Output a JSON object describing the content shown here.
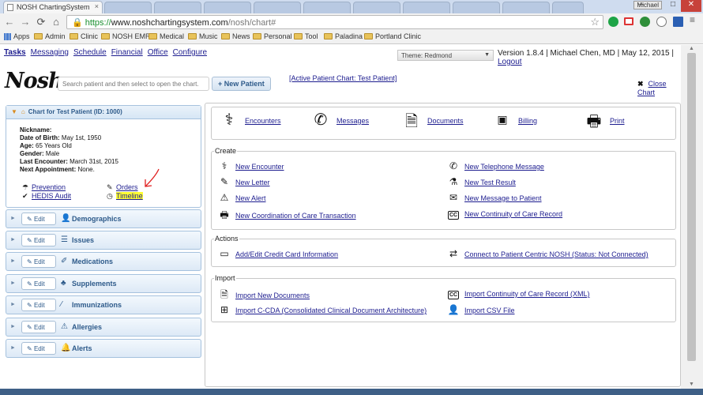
{
  "browser": {
    "active_tab_title": "NOSH ChartingSystem",
    "user_chip": "Michael",
    "url": {
      "scheme": "https://",
      "host": "www.noshchartingsystem.com",
      "path": "/nosh/chart#"
    },
    "bookmarks": [
      "Apps",
      "Admin",
      "Clinic",
      "NOSH EMR",
      "Medical",
      "Music",
      "News",
      "Personal",
      "Tool",
      "Paladina",
      "Portland Clinic"
    ]
  },
  "nav": {
    "links": [
      "Tasks",
      "Messaging",
      "Schedule",
      "Financial",
      "Office",
      "Configure"
    ],
    "theme_select": "Theme: Redmond",
    "version": "Version 1.8.4",
    "user": "Michael Chen, MD",
    "date": "May 12, 2015",
    "logout": "Logout",
    "sep": "|"
  },
  "header": {
    "logo": "Nosh",
    "search_placeholder": "Search patient and then select to open the chart.",
    "new_patient": "New Patient",
    "active_chart": "[Active Patient Chart: Test Patient]",
    "close_chart": "Close Chart"
  },
  "patient": {
    "panel_title": "Chart for Test Patient (ID: 1000)",
    "fields": [
      {
        "label": "Nickname:",
        "value": ""
      },
      {
        "label": "Date of Birth:",
        "value": "May 1st, 1950"
      },
      {
        "label": "Age:",
        "value": "65 Years Old"
      },
      {
        "label": "Gender:",
        "value": "Male"
      },
      {
        "label": "Last Encounter:",
        "value": "March 31st, 2015"
      },
      {
        "label": "Next Appointment:",
        "value": "None."
      }
    ],
    "links": {
      "prevention": "Prevention",
      "hedis": "HEDIS Audit",
      "orders": "Orders",
      "timeline": "Timeline"
    }
  },
  "sections": {
    "edit_label": "Edit",
    "items": [
      "Demographics",
      "Issues",
      "Medications",
      "Supplements",
      "Immunizations",
      "Allergies",
      "Alerts"
    ]
  },
  "toplinks": [
    "Encounters",
    "Messages",
    "Documents",
    "Billing",
    "Print"
  ],
  "create": {
    "legend": "Create",
    "left": [
      "New Encounter",
      "New Letter",
      "New Alert",
      "New Coordination of Care Transaction"
    ],
    "right": [
      "New Telephone Message",
      "New Test Result",
      "New Message to Patient",
      "New Continuity of Care Record"
    ]
  },
  "actions": {
    "legend": "Actions",
    "left": "Add/Edit Credit Card Information",
    "right": "Connect to Patient Centric NOSH (Status: Not Connected)"
  },
  "import": {
    "legend": "Import",
    "left": [
      "Import New Documents",
      "Import C-CDA (Consolidated Clinical Document Architecture)"
    ],
    "right": [
      "Import Continuity of Care Record (XML)",
      "Import CSV File"
    ]
  },
  "cc_badge": "CC",
  "colors": {
    "accent": "#2d5a8a",
    "link": "#1d1d8f",
    "highlight": "#ffff33",
    "annotation": "#e02020"
  }
}
